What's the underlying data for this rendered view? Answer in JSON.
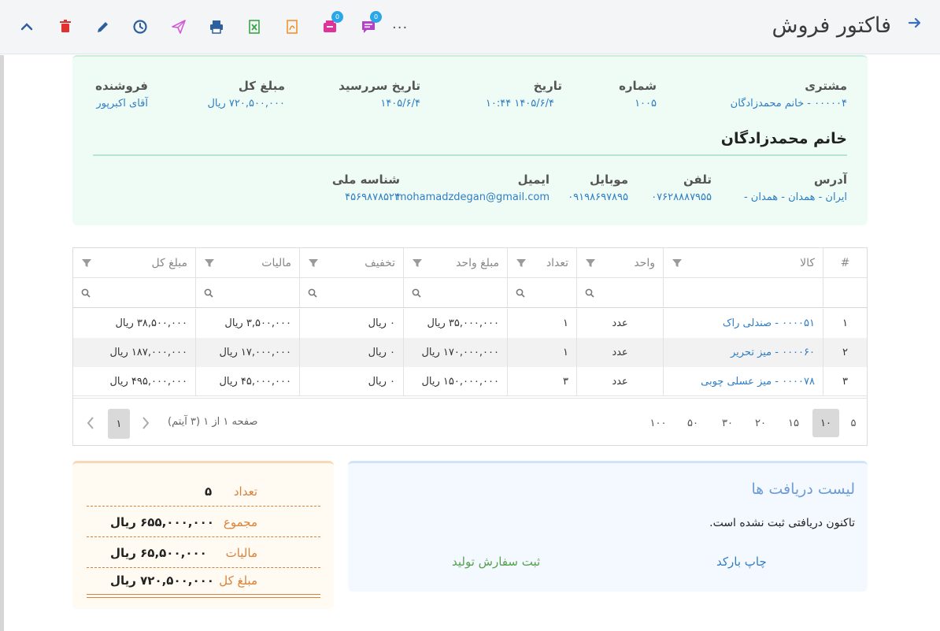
{
  "header": {
    "title": "فاکتور فروش",
    "toolbar_more": "..."
  },
  "toolbar_icons": [
    {
      "name": "back-arrow-icon"
    },
    {
      "name": "chevron-up-icon"
    },
    {
      "name": "delete-icon",
      "color": "#e0302f"
    },
    {
      "name": "edit-icon",
      "color": "#2d5e9e"
    },
    {
      "name": "history-icon",
      "color": "#2d5e9e"
    },
    {
      "name": "send-icon",
      "color": "#d15ad8"
    },
    {
      "name": "print-icon",
      "color": "#2d5e9e"
    },
    {
      "name": "excel-icon",
      "color": "#3aa547"
    },
    {
      "name": "pdf-icon",
      "color": "#f0952d"
    },
    {
      "name": "inbox-icon",
      "color": "#e0329a"
    },
    {
      "name": "comment-icon",
      "color": "#b541c8"
    }
  ],
  "invoice": {
    "customer_label": "مشتری",
    "customer_value": "۰۰۰۰۰۴ - خانم محمدزادگان",
    "number_label": "شماره",
    "number_value": "۱۰۰۵",
    "date_label": "تاریخ",
    "date_value": "۱۴۰۵/۶/۴   ۱۰:۴۴",
    "due_label": "تاریخ سررسید",
    "due_value": "۱۴۰۵/۶/۴",
    "total_label": "مبلغ کل",
    "total_value": "۷۲۰,۵۰۰,۰۰۰ ریال",
    "seller_label": "فروشنده",
    "seller_value": "آقای اکبرپور",
    "customer_name": "خانم محمدزادگان",
    "address_label": "آدرس",
    "address_value": "ایران - همدان - همدان -",
    "phone_label": "تلفن",
    "phone_value": "۰۷۶۲۸۸۸۷۹۵۵",
    "mobile_label": "موبایل",
    "mobile_value": "۰۹۱۹۸۶۹۷۸۹۵",
    "email_label": "ایمیل",
    "email_value": "mohamadzdegan@gmail.com",
    "national_label": "شناسه ملی",
    "national_value": "۴۵۶۹۸۷۸۵۲۴"
  },
  "table": {
    "columns": [
      "#",
      "کالا",
      "واحد",
      "تعداد",
      "مبلغ واحد",
      "تخفیف",
      "مالیات",
      "مبلغ کل"
    ],
    "rows": [
      {
        "idx": "۱",
        "item": "۰۰۰۰۵۱ - صندلی راک",
        "unit": "عدد",
        "qty": "۱",
        "unit_price": "۳۵,۰۰۰,۰۰۰ ریال",
        "discount": "۰ ریال",
        "tax": "۳,۵۰۰,۰۰۰ ریال",
        "total": "۳۸,۵۰۰,۰۰۰ ریال"
      },
      {
        "idx": "۲",
        "item": "۰۰۰۰۶۰ - میز تحریر",
        "unit": "عدد",
        "qty": "۱",
        "unit_price": "۱۷۰,۰۰۰,۰۰۰ ریال",
        "discount": "۰ ریال",
        "tax": "۱۷,۰۰۰,۰۰۰ ریال",
        "total": "۱۸۷,۰۰۰,۰۰۰ ریال"
      },
      {
        "idx": "۳",
        "item": "۰۰۰۰۷۸ - میز عسلی چوبی",
        "unit": "عدد",
        "qty": "۳",
        "unit_price": "۱۵۰,۰۰۰,۰۰۰ ریال",
        "discount": "۰ ریال",
        "tax": "۴۵,۰۰۰,۰۰۰ ریال",
        "total": "۴۹۵,۰۰۰,۰۰۰ ریال"
      }
    ],
    "page_sizes": [
      "۵",
      "۱۰",
      "۱۵",
      "۲۰",
      "۳۰",
      "۵۰",
      "۱۰۰"
    ],
    "active_page_size": "۱۰",
    "page_info": "صفحه ۱ از ۱ (۳ آیتم)",
    "current_page": "۱"
  },
  "totals": {
    "count_label": "تعداد",
    "count_value": "۵",
    "sum_label": "مجموع",
    "sum_value": "۶۵۵,۰۰۰,۰۰۰ ریال",
    "tax_label": "مالیات",
    "tax_value": "۶۵,۵۰۰,۰۰۰ ریال",
    "total_label": "مبلغ کل",
    "total_value": "۷۲۰,۵۰۰,۰۰۰ ریال"
  },
  "receipts": {
    "title": "لیست دریافت ها",
    "empty_text": "تاکنون دریافتی ثبت نشده است.",
    "barcode_link": "چاپ بارکد",
    "production_link": "ثبت سفارش تولید"
  }
}
